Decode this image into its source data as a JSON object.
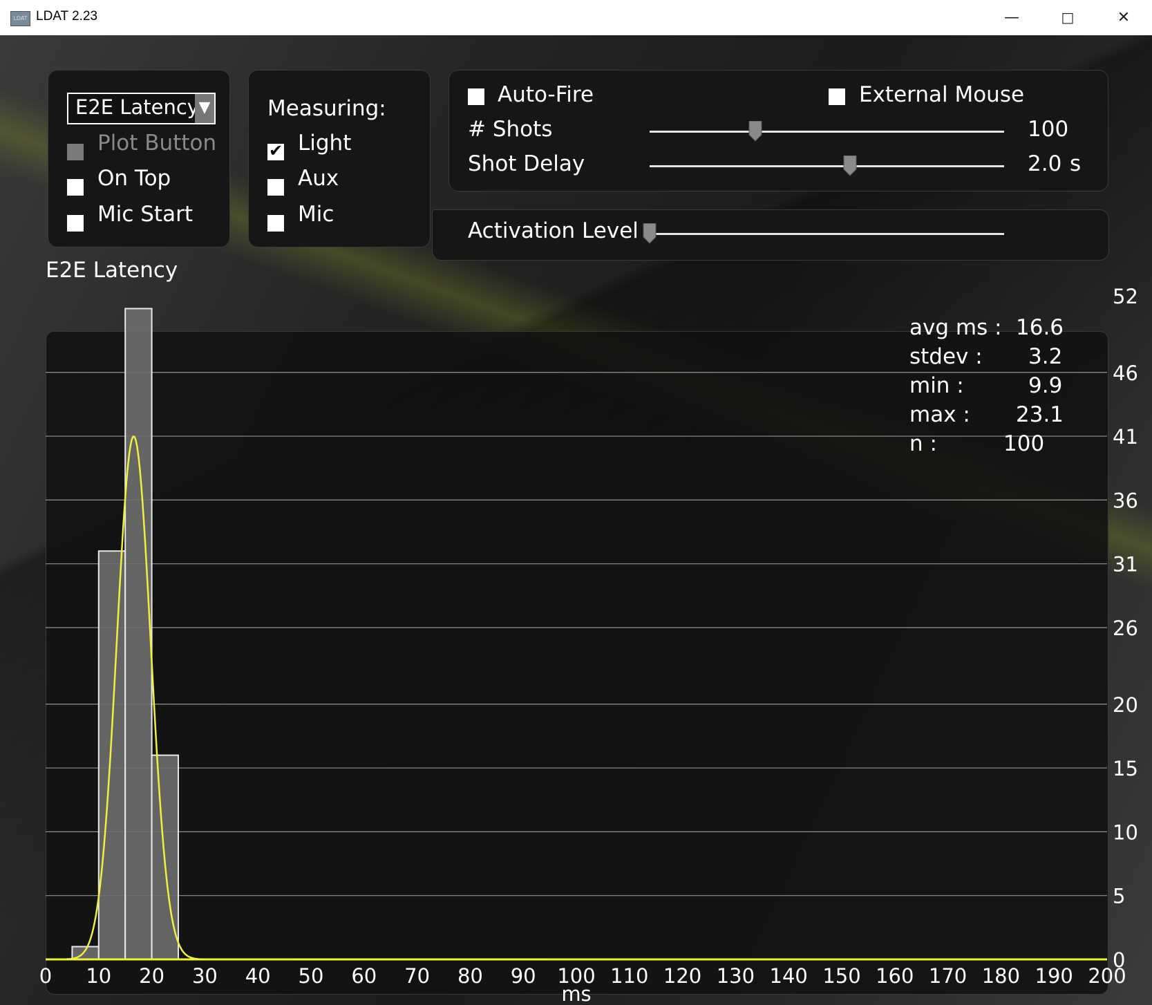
{
  "window": {
    "title": "LDAT 2.23",
    "icon": "ldat-app-icon",
    "controls": [
      "minimize-icon",
      "maximize-icon",
      "close-icon"
    ],
    "icon_glyph": "LDAT"
  },
  "mode_panel": {
    "dropdown": {
      "selected": "E2E  Latency"
    },
    "checkboxes": [
      {
        "label": "Plot  Button",
        "checked": false,
        "enabled": false
      },
      {
        "label": "On  Top",
        "checked": false,
        "enabled": true
      },
      {
        "label": "Mic  Start",
        "checked": false,
        "enabled": true
      }
    ]
  },
  "measuring_panel": {
    "heading": "Measuring:",
    "checkboxes": [
      {
        "label": "Light",
        "checked": true
      },
      {
        "label": "Aux",
        "checked": false
      },
      {
        "label": "Mic",
        "checked": false
      }
    ]
  },
  "fire_panel": {
    "auto_fire": {
      "label": "Auto-Fire",
      "checked": false
    },
    "external_mouse": {
      "label": "External  Mouse",
      "checked": false
    },
    "shots": {
      "label": "#  Shots",
      "value": "100",
      "fraction": 0.3
    },
    "shot_delay": {
      "label": "Shot  Delay",
      "value": "2.0",
      "unit": "s",
      "fraction": 0.57
    }
  },
  "activation_panel": {
    "label": "Activation  Level",
    "fraction": 0.0
  },
  "chart_title": "E2E  Latency",
  "stats": [
    {
      "label": "avg  ms  :",
      "value": "16.6"
    },
    {
      "label": "stdev  :",
      "value": "3.2"
    },
    {
      "label": "min  :",
      "value": "9.9"
    },
    {
      "label": "max  :",
      "value": "23.1"
    },
    {
      "label": "n  :",
      "value": "100"
    }
  ],
  "colors": {
    "curve": "#f0f040",
    "bar_fill": "#6e6e6e",
    "bar_stroke": "#e8e8e8",
    "grid": "#bdbdbd"
  },
  "chart_data": {
    "type": "bar",
    "title": "E2E  Latency",
    "xlabel": "ms",
    "ylabel": "",
    "xlim": [
      0,
      200
    ],
    "ylim": [
      0,
      52
    ],
    "x_ticks": [
      "0",
      "10",
      "20",
      "30",
      "40",
      "50",
      "60",
      "70",
      "80",
      "90",
      "100",
      "110",
      "120",
      "130",
      "140",
      "150",
      "160",
      "170",
      "180",
      "190",
      "200"
    ],
    "y_ticks": [
      "0",
      "5",
      "10",
      "15",
      "20",
      "26",
      "31",
      "36",
      "41",
      "46",
      "52"
    ],
    "y_tick_values": [
      0,
      5,
      10,
      15,
      20,
      26,
      31,
      36,
      41,
      46,
      52
    ],
    "grid": true,
    "bins": [
      {
        "start": 5,
        "end": 10,
        "count": 1
      },
      {
        "start": 10,
        "end": 15,
        "count": 32
      },
      {
        "start": 15,
        "end": 20,
        "count": 51
      },
      {
        "start": 20,
        "end": 25,
        "count": 16
      }
    ],
    "curve": {
      "type": "gaussian",
      "mean": 16.6,
      "stdev": 3.2,
      "peak": 41
    }
  }
}
